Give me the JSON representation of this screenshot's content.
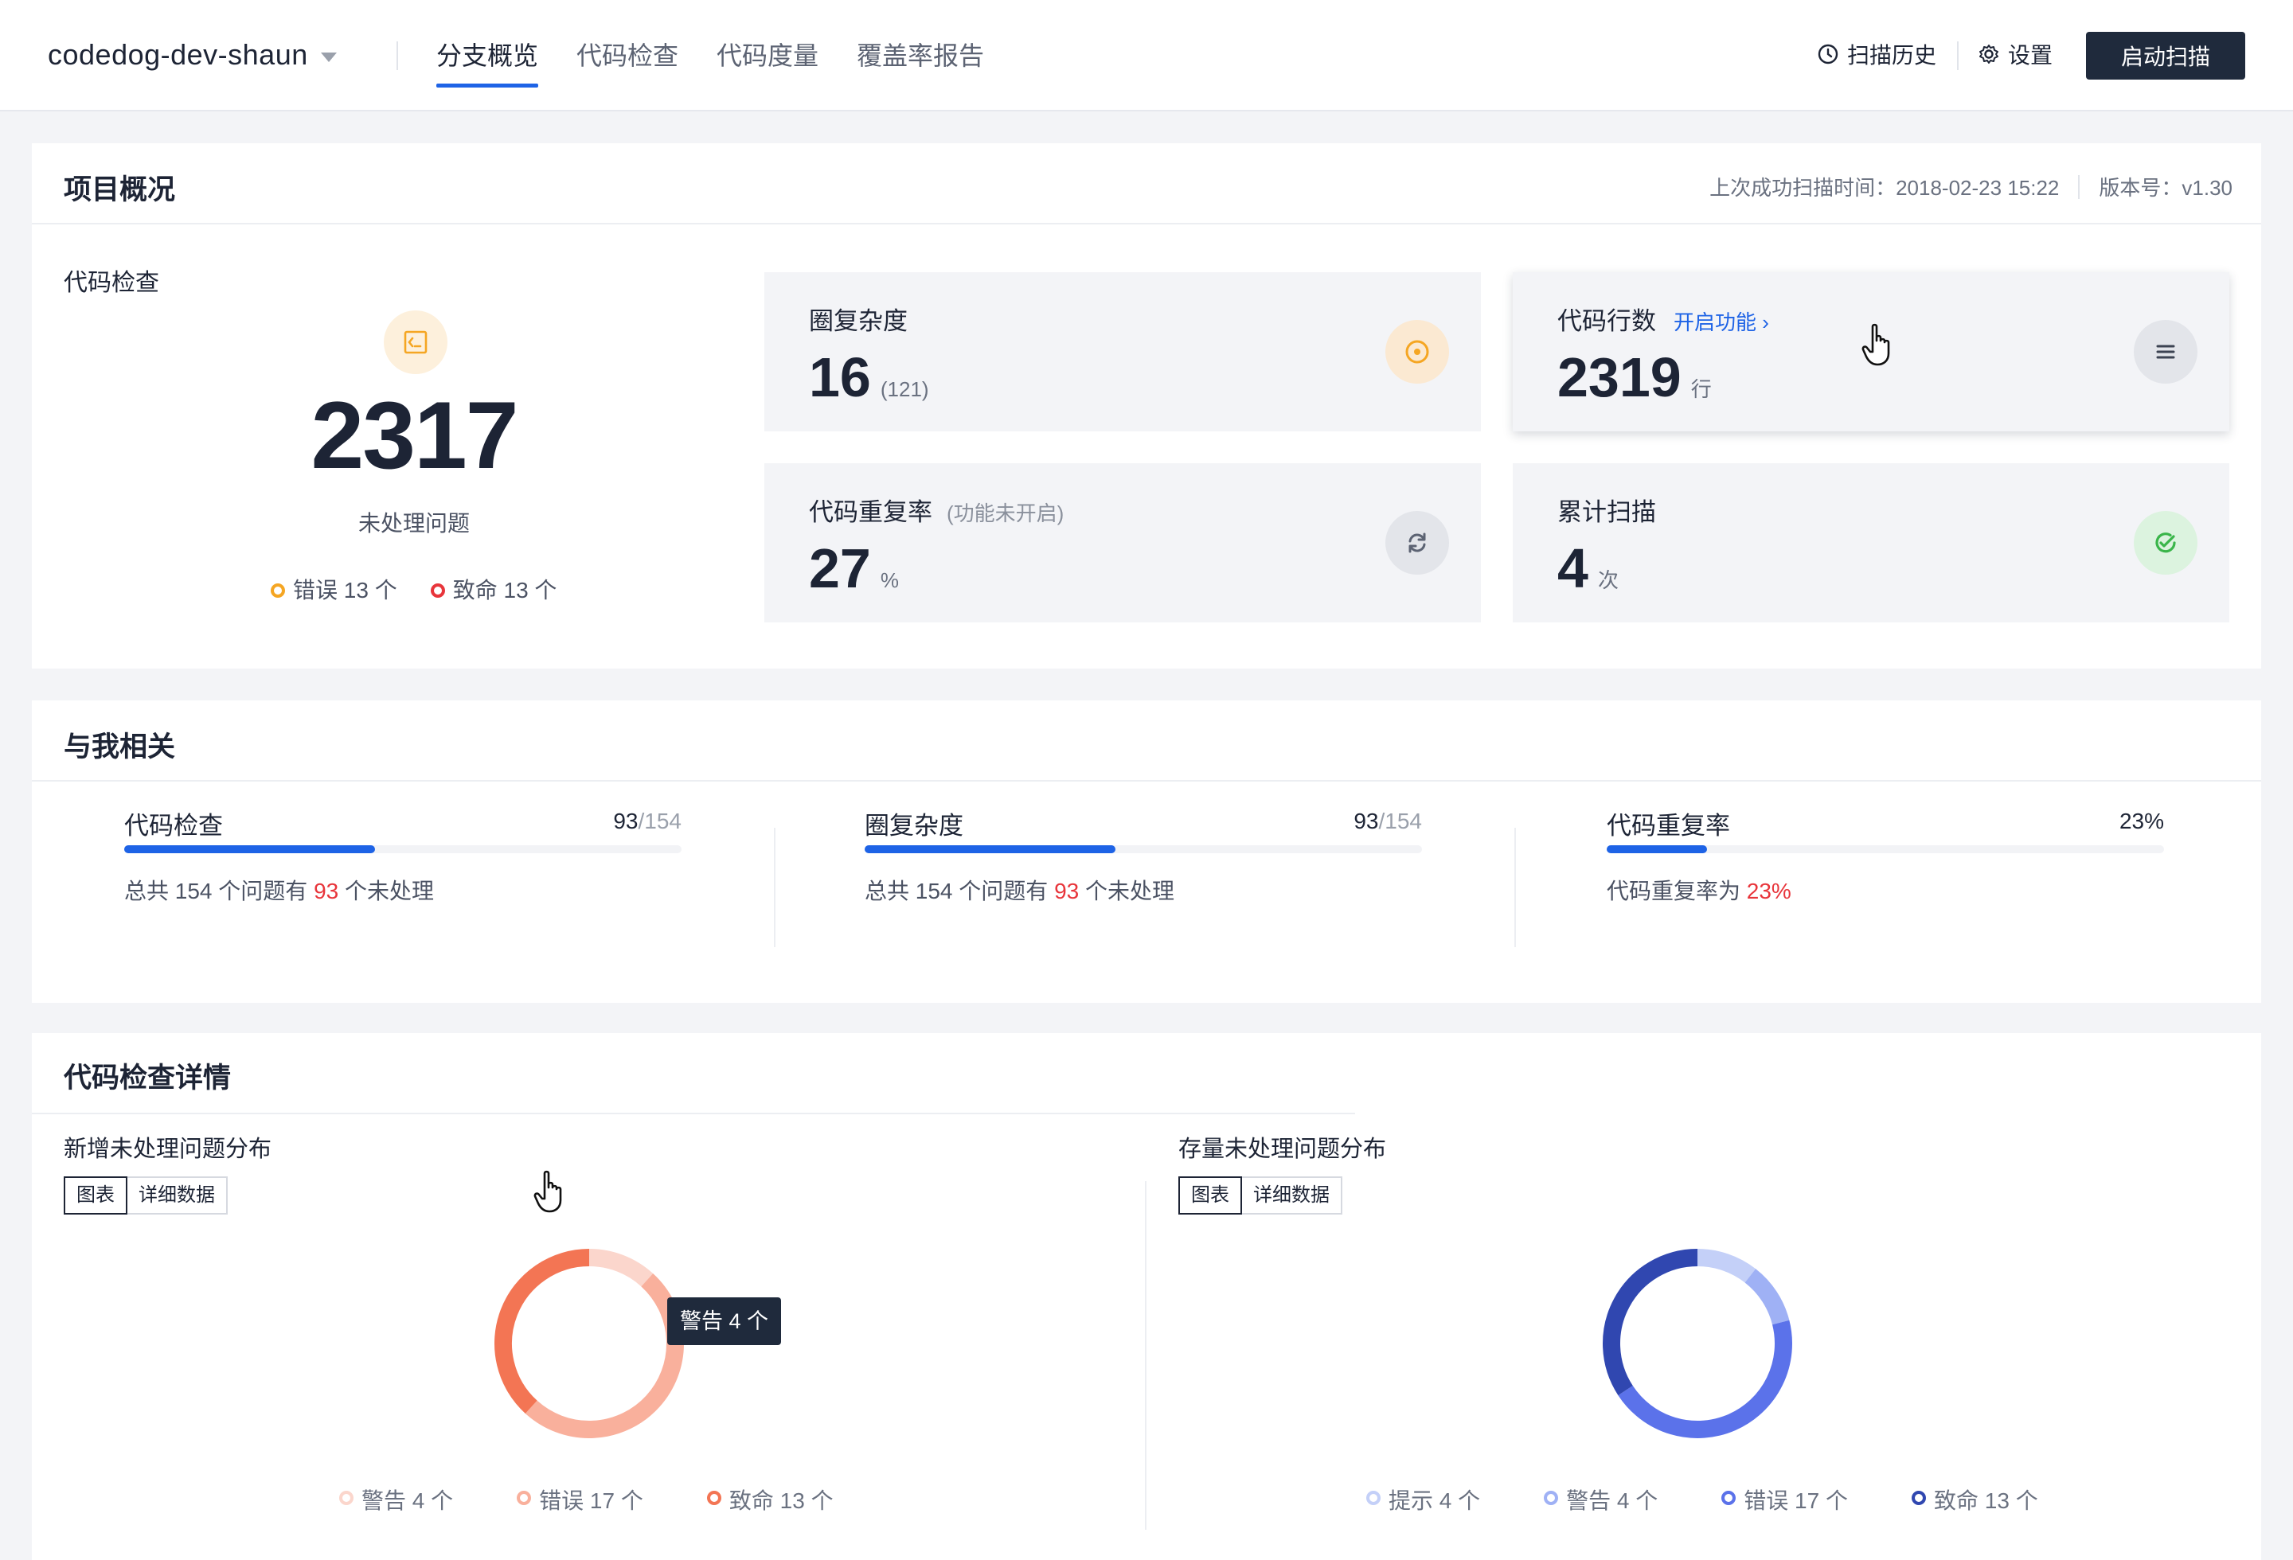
{
  "header": {
    "project_name": "codedog-dev-shaun",
    "tabs": [
      "分支概览",
      "代码检查",
      "代码度量",
      "覆盖率报告"
    ],
    "active_tab": 0,
    "scan_history_label": "扫描历史",
    "settings_label": "设置",
    "start_scan_label": "启动扫描"
  },
  "overview": {
    "title": "项目概况",
    "last_scan": "上次成功扫描时间：2018-02-23 15:22",
    "version": "版本号：v1.30",
    "code_check": {
      "label": "代码检查",
      "count": "2317",
      "sub_label": "未处理问题",
      "legend": [
        {
          "label": "错误 13 个",
          "color": "#f5a623"
        },
        {
          "label": "致命 13 个",
          "color": "#e8353b"
        }
      ]
    },
    "metrics": {
      "complexity": {
        "label": "圈复杂度",
        "value": "16",
        "unit": "(121)",
        "icon": "target-icon",
        "icon_color": "#f5a623"
      },
      "lines": {
        "label": "代码行数",
        "link": "开启功能 ›",
        "value": "2319",
        "unit": "行",
        "icon": "list-icon",
        "icon_color": "#3c4352"
      },
      "duplication": {
        "label": "代码重复率",
        "hint": "(功能未开启)",
        "value": "27",
        "unit": "%",
        "icon": "refresh-icon",
        "icon_color": "#5c6373"
      },
      "scans": {
        "label": "累计扫描",
        "value": "4",
        "unit": "次",
        "icon": "check-cycle-icon",
        "icon_color": "#3ab54a"
      }
    }
  },
  "related": {
    "title": "与我相关",
    "columns": [
      {
        "title": "代码检查",
        "count": "93",
        "total": "/154",
        "progress": 0.45,
        "desc_prefix": "总共 154 个问题有 ",
        "desc_value": "93",
        "desc_suffix": " 个未处理"
      },
      {
        "title": "圈复杂度",
        "count": "93",
        "total": "/154",
        "progress": 0.45,
        "desc_prefix": "总共 154 个问题有 ",
        "desc_value": "93",
        "desc_suffix": " 个未处理"
      },
      {
        "title": "代码重复率",
        "count": "23%",
        "total": "",
        "progress": 0.18,
        "desc_prefix": "代码重复率为 ",
        "desc_value": "23%",
        "desc_suffix": ""
      }
    ]
  },
  "details": {
    "title": "代码检查详情",
    "left": {
      "title": "新增未处理问题分布",
      "seg": [
        "图表",
        "详细数据"
      ],
      "tooltip": "警告 4 个",
      "legend": [
        {
          "label": "警告 4 个",
          "value": 4,
          "color": "#fbd6cc"
        },
        {
          "label": "错误 17 个",
          "value": 17,
          "color": "#f9b09c"
        },
        {
          "label": "致命 13 个",
          "value": 13,
          "color": "#f37554"
        }
      ]
    },
    "right": {
      "title": "存量未处理问题分布",
      "seg": [
        "图表",
        "详细数据"
      ],
      "legend": [
        {
          "label": "提示 4 个",
          "value": 4,
          "color": "#c4d0f8"
        },
        {
          "label": "警告 4 个",
          "value": 4,
          "color": "#9fb1f5"
        },
        {
          "label": "错误 17 个",
          "value": 17,
          "color": "#5b72ea"
        },
        {
          "label": "致命 13 个",
          "value": 13,
          "color": "#3047b0"
        }
      ]
    }
  }
}
